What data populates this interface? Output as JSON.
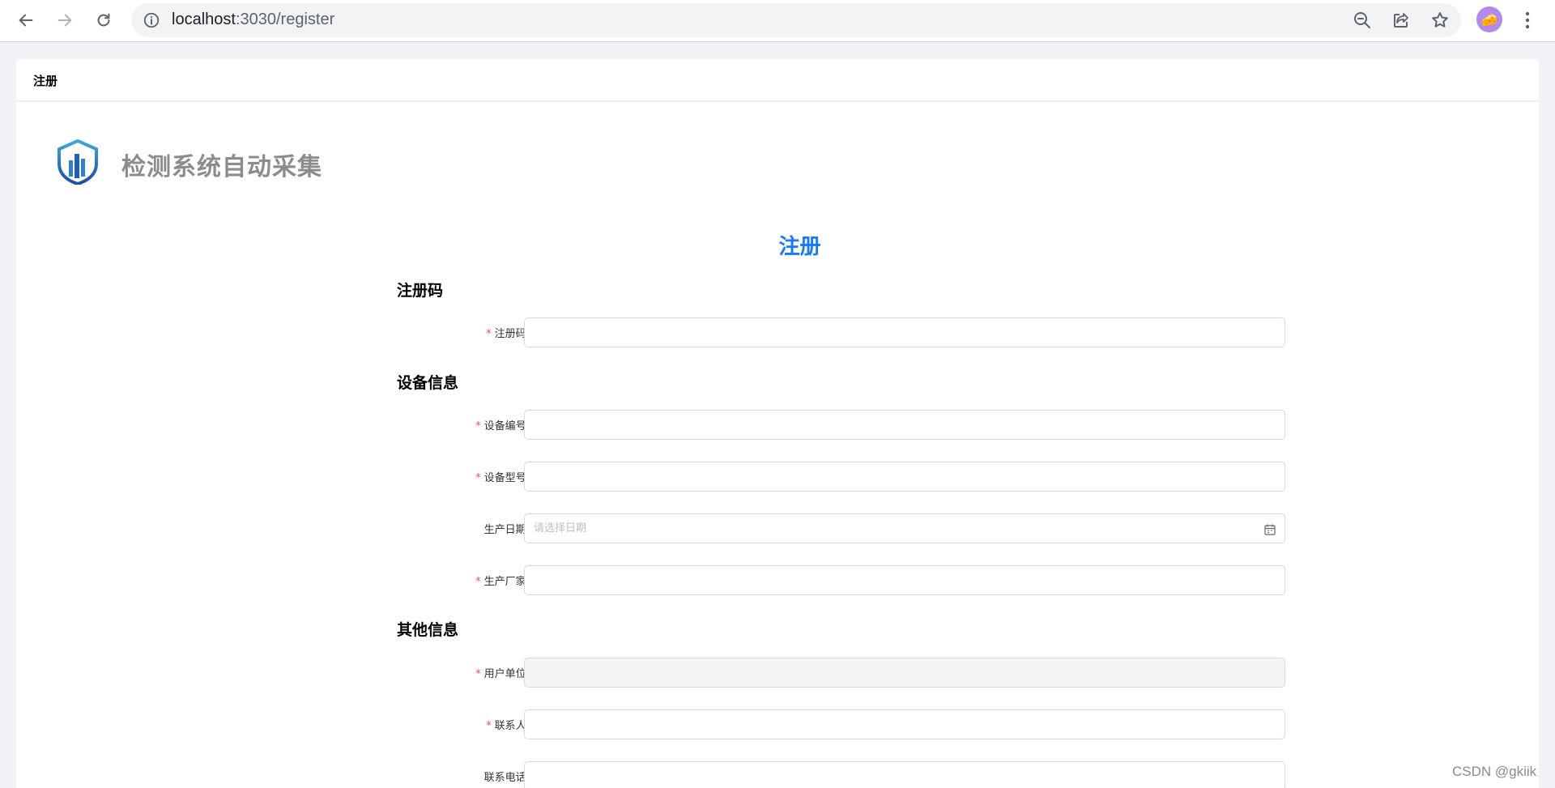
{
  "browser": {
    "url_host": "localhost",
    "url_path": ":3030/register",
    "avatar_glyph": "🧀"
  },
  "tab": {
    "title": "注册"
  },
  "app": {
    "title": "检测系统自动采集"
  },
  "page": {
    "heading": "注册"
  },
  "sections": {
    "registration": {
      "title": "注册码",
      "code_label": "注册码:"
    },
    "device": {
      "title": "设备信息",
      "number_label": "设备编号:",
      "model_label": "设备型号:",
      "date_label": "生产日期:",
      "date_placeholder": "请选择日期",
      "maker_label": "生产厂家:"
    },
    "other": {
      "title": "其他信息",
      "unit_label": "用户单位:",
      "contact_label": "联系人:",
      "phone_label": "联系电话:"
    }
  },
  "required_mark": "*",
  "watermark": "CSDN @gkiik",
  "colors": {
    "accent": "#1677ff",
    "required": "#ff4d4f",
    "app_title": "#8c8c8c"
  },
  "icons": [
    "back-arrow-icon",
    "forward-arrow-icon",
    "reload-icon",
    "info-icon",
    "zoom-icon",
    "share-icon",
    "star-icon",
    "menu-dots-icon",
    "shield-logo-icon",
    "calendar-icon"
  ]
}
